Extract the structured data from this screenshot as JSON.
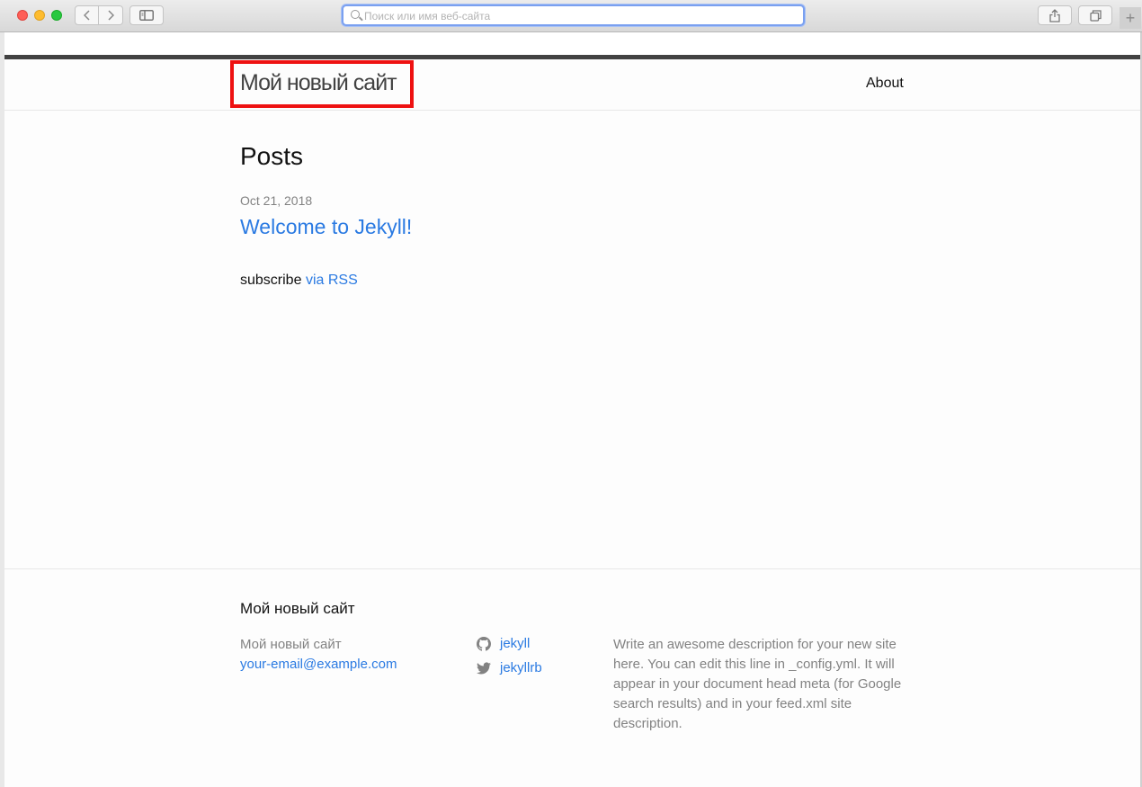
{
  "browser": {
    "url_placeholder": "Поиск или имя веб-сайта",
    "new_tab": "+"
  },
  "header": {
    "site_title": "Мой новый сайт",
    "nav": [
      {
        "label": "About"
      }
    ]
  },
  "main": {
    "heading": "Posts",
    "posts": [
      {
        "date": "Oct 21, 2018",
        "title": "Welcome to Jekyll!"
      }
    ],
    "subscribe_text": "subscribe",
    "subscribe_link": "via RSS"
  },
  "footer": {
    "heading": "Мой новый сайт",
    "name": "Мой новый сайт",
    "email": "your-email@example.com",
    "github": "jekyll",
    "twitter": "jekyllrb",
    "description": "Write an awesome description for your new site here. You can edit this line in _config.yml. It will appear in your document head meta (for Google search results) and in your feed.xml site description."
  },
  "colors": {
    "accent": "#2a7ae2",
    "highlight": "#ee1111",
    "header_bar": "#424242"
  }
}
